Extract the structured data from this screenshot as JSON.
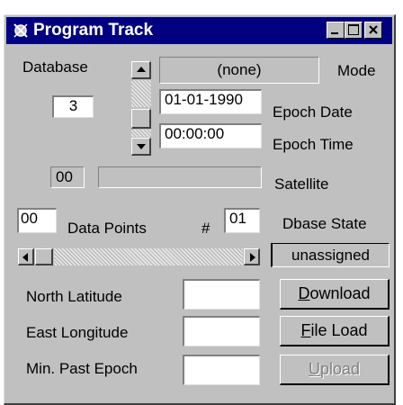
{
  "window": {
    "title": "Program Track"
  },
  "labels": {
    "database": "Database",
    "mode": "Mode",
    "epoch_date": "Epoch Date",
    "epoch_time": "Epoch Time",
    "satellite": "Satellite",
    "data_points": "Data Points",
    "hash": "#",
    "dbase_state": "Dbase State",
    "north_latitude": "North Latitude",
    "east_longitude": "East Longitude",
    "min_past_epoch": "Min. Past Epoch"
  },
  "values": {
    "database_name": "(none)",
    "count": "3",
    "epoch_date": "01-01-1990",
    "epoch_time": "00:00:00",
    "satellite_num": "00",
    "satellite_name": "",
    "data_points": "00",
    "point_index": "01",
    "dbase_state": "unassigned",
    "north_latitude": "",
    "east_longitude": "",
    "min_past_epoch": ""
  },
  "buttons": {
    "download_first": "D",
    "download_rest": "ownload",
    "fileload_first": "F",
    "fileload_rest": "ile Load",
    "upload_first": "U",
    "upload_rest": "pload"
  },
  "icons": {
    "app": "satellite-icon",
    "minimize": "minimize-icon",
    "maximize": "maximize-icon",
    "close": "close-icon"
  },
  "colors": {
    "titlebar": "#000080",
    "face": "#c0c0c0"
  }
}
